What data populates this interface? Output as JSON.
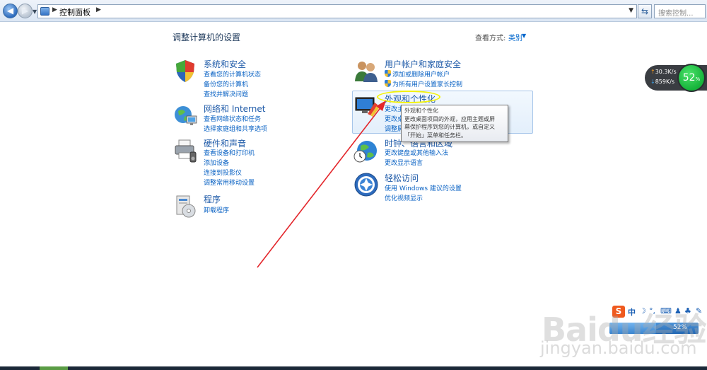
{
  "address_bar": {
    "breadcrumb": "控制面板",
    "search_placeholder": "搜索控制..."
  },
  "header": {
    "title": "调整计算机的设置",
    "view_by_label": "查看方式:",
    "view_by_value": "类别"
  },
  "categories_left": [
    {
      "title": "系统和安全",
      "icon": "shield-icon",
      "links": [
        "查看您的计算机状态",
        "备份您的计算机",
        "查找并解决问题"
      ]
    },
    {
      "title": "网络和 Internet",
      "icon": "network-globe-icon",
      "links": [
        "查看网络状态和任务",
        "选择家庭组和共享选项"
      ]
    },
    {
      "title": "硬件和声音",
      "icon": "printer-icon",
      "links": [
        "查看设备和打印机",
        "添加设备",
        "连接到投影仪",
        "调整常用移动设置"
      ]
    },
    {
      "title": "程序",
      "icon": "programs-icon",
      "links": [
        "卸载程序"
      ]
    }
  ],
  "categories_right": [
    {
      "title": "用户帐户和家庭安全",
      "icon": "users-icon",
      "links": [
        "添加或删除用户帐户",
        "为所有用户设置家长控制"
      ]
    },
    {
      "title": "外观和个性化",
      "icon": "appearance-icon",
      "links": [
        "更改主",
        "更改桌",
        "调整屏"
      ]
    },
    {
      "title": "时钟、语言和区域",
      "icon": "clock-globe-icon",
      "links": [
        "更改键盘或其他输入法",
        "更改显示语言"
      ]
    },
    {
      "title": "轻松访问",
      "icon": "ease-of-access-icon",
      "links": [
        "使用 Windows 建议的设置",
        "优化视频显示"
      ]
    }
  ],
  "tooltip": {
    "lines": [
      "外观和个性化",
      "更改桌面项目的外观，应用主题或屏",
      "幕保护程序到您的计算机，或自定义",
      "「开始」菜单和任务栏。"
    ]
  },
  "net_meter": {
    "upload": "30.3",
    "download": "859",
    "unit": "K/s",
    "percent": "52",
    "percent_sign": "%"
  },
  "ime_bar": {
    "logo": "S",
    "mode": "中"
  },
  "progress": {
    "label": "52%",
    "fraction": 0.52
  },
  "watermark": {
    "logo": "Baidu经验",
    "url": "jingyan.baidu.com"
  },
  "colors": {
    "link": "#0b63c4",
    "title": "#1e5aa8",
    "annotation_arrow": "#e3262b",
    "highlight": "#f4f30a"
  }
}
